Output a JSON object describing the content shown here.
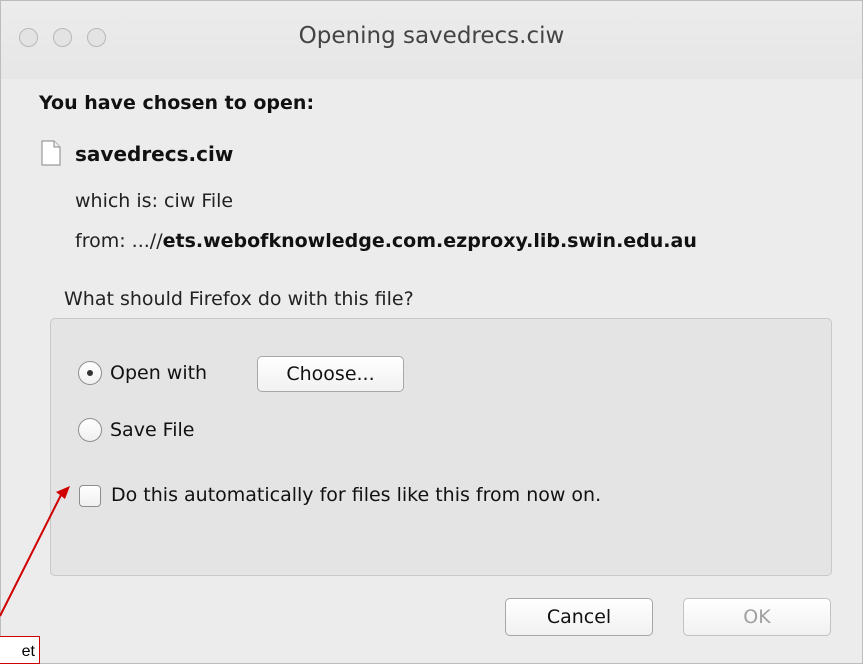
{
  "window": {
    "title": "Opening savedrecs.ciw"
  },
  "dialog": {
    "heading": "You have chosen to open:",
    "file_name": "savedrecs.ciw",
    "type_label": "which is:",
    "type_value": "ciw File",
    "from_label": "from:",
    "from_prefix": "...//",
    "from_host": "ets.webofknowledge.com.ezproxy.lib.swin.edu.au",
    "question": "What should Firefox do with this file?",
    "options": {
      "open_with_label": "Open with",
      "choose_button": "Choose...",
      "save_file_label": "Save File",
      "auto_label": "Do this automatically for files like this from now on."
    },
    "state": {
      "selected_option": "open_with",
      "auto_checked": false
    },
    "buttons": {
      "cancel": "Cancel",
      "ok": "OK"
    }
  },
  "annotation": {
    "callout_text": "et",
    "color": "#d00000"
  }
}
